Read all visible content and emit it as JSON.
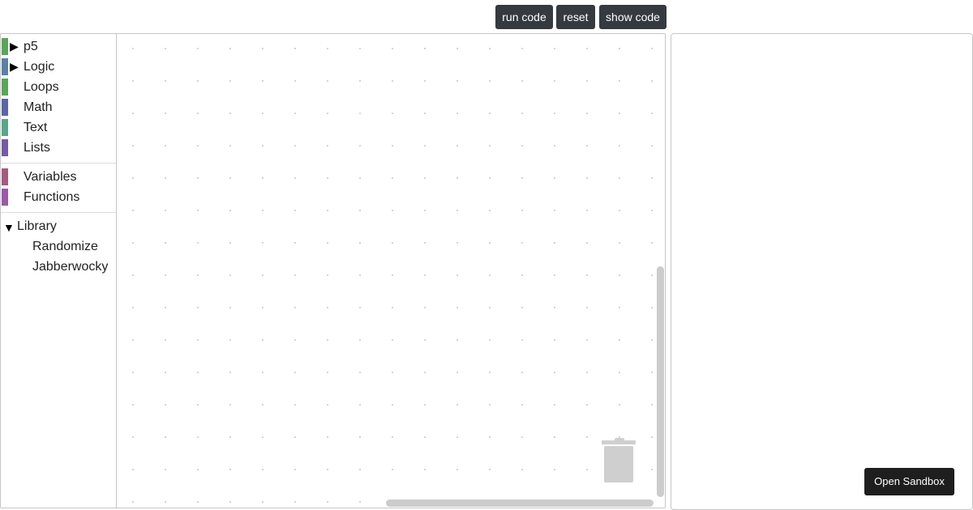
{
  "toolbar": {
    "run_label": "run code",
    "reset_label": "reset",
    "show_label": "show code"
  },
  "toolbox": {
    "categories": [
      {
        "label": "p5",
        "color": "#5ba55b",
        "expandable": true
      },
      {
        "label": "Logic",
        "color": "#5b80a5",
        "expandable": true
      },
      {
        "label": "Loops",
        "color": "#5ba55b",
        "expandable": false
      },
      {
        "label": "Math",
        "color": "#5b67a5",
        "expandable": false
      },
      {
        "label": "Text",
        "color": "#5ba58c",
        "expandable": false
      },
      {
        "label": "Lists",
        "color": "#745ba5",
        "expandable": false
      },
      {
        "label": "Variables",
        "color": "#a55b80",
        "expandable": false
      },
      {
        "label": "Functions",
        "color": "#995ba5",
        "expandable": false
      }
    ],
    "library": {
      "label": "Library",
      "expanded": true,
      "items": [
        "Randomize",
        "Jabberwocky"
      ]
    }
  },
  "workspace": {
    "trash_icon": "trash-can-icon"
  },
  "preview": {
    "sandbox_label": "Open Sandbox"
  }
}
